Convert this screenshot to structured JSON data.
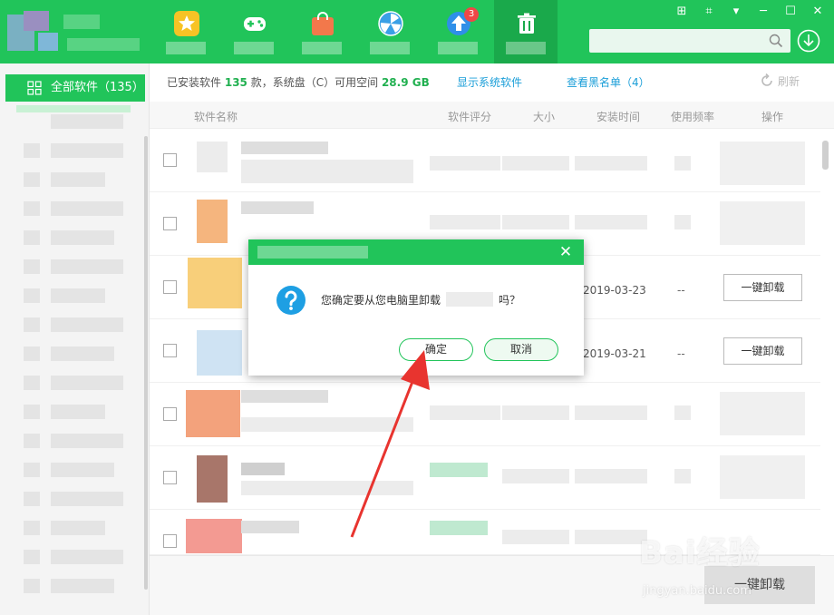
{
  "topbar": {
    "update_badge": "3",
    "search_placeholder": "",
    "colors": {
      "bar": "#21c45a",
      "active_tab": "#1aa94b"
    }
  },
  "sidebar": {
    "active_label": "全部软件（135）"
  },
  "info": {
    "prefix": "已安装软件",
    "count": "135",
    "mid": "款，系统盘（C）可用空间",
    "free_space": "28.9 GB"
  },
  "links": {
    "show_system": "显示系统软件",
    "blacklist": "查看黑名单（4）",
    "refresh": "刷新"
  },
  "table": {
    "columns": [
      "软件名称",
      "软件评分",
      "大小",
      "安装时间",
      "使用频率",
      "操作"
    ]
  },
  "rows": [
    {
      "date": "2019-03-23",
      "freq": "--",
      "action": "一键卸载"
    },
    {
      "date": "2019-03-21",
      "freq": "--",
      "action": "一键卸载"
    }
  ],
  "bottom": {
    "bulk_uninstall": "一键卸载"
  },
  "dialog": {
    "msg_before": "您确定要从您电脑里卸载",
    "msg_after": "吗？",
    "ok": "确定",
    "cancel": "取消"
  },
  "watermark": {
    "main": "Bai经验",
    "sub": "jingyan.baidu.com"
  }
}
